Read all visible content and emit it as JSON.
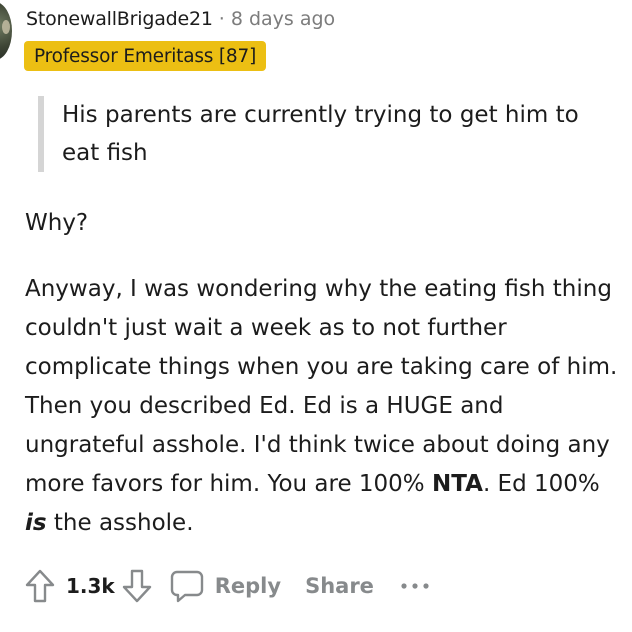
{
  "comment": {
    "author": "StonewallBrigade21",
    "separator": "·",
    "age": "8 days ago",
    "flair": "Professor Emeritass [87]",
    "quote": "His parents are currently trying to get him to eat fish",
    "paragraph1": "Why?",
    "paragraph2_part1": "Anyway, I was wondering why the eating fish thing couldn't just wait a week as to not further complicate things when you are taking care of him. Then you described Ed. Ed is a HUGE and ungrateful asshole. I'd think twice about doing any more favors for him. You are 100% ",
    "paragraph2_strong": "NTA",
    "paragraph2_part2": ". Ed 100% ",
    "paragraph2_emph": "is",
    "paragraph2_part3": " the asshole."
  },
  "actions": {
    "upvote_icon": "arrow-up-outline-icon",
    "score": "1.3k",
    "downvote_icon": "arrow-down-outline-icon",
    "reply_icon": "speech-bubble-icon",
    "reply_label": "Reply",
    "share_label": "Share",
    "more_icon": "ellipsis-icon"
  },
  "colors": {
    "flair_bg": "#ecbf13",
    "muted_text": "#878a8c",
    "quote_bar": "#d5d5d5"
  }
}
